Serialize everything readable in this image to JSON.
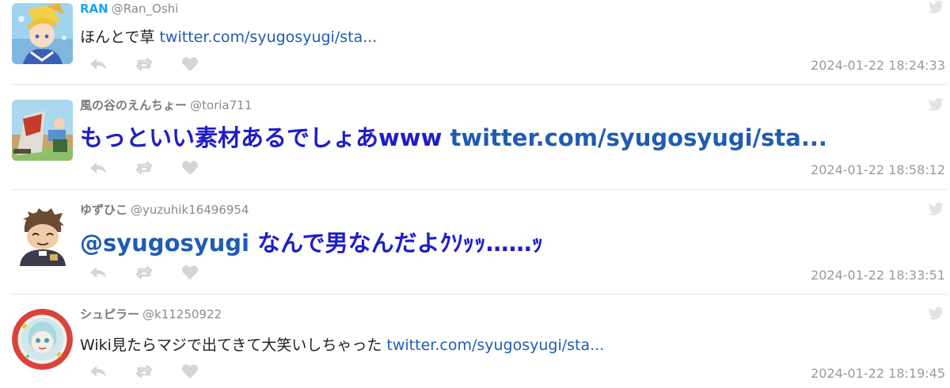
{
  "tweets": [
    {
      "name": "RAN",
      "handle": "@Ran_Oshi",
      "text": "ほんとで草 ",
      "link": "twitter.com/syugosyugi/sta...",
      "time": "2024-01-22 18:24:33"
    },
    {
      "name": "風の谷のえんちょー",
      "handle": "@toria711",
      "text": "もっといい素材あるでしょあwww ",
      "link": "twitter.com/syugosyugi/sta...",
      "time": "2024-01-22 18:58:12"
    },
    {
      "name": "ゆずひこ",
      "handle": "@yuzuhik16496954",
      "mention": "@syugosyugi",
      "text": " なんで男なんだよｸｿｯｯ……ｯ",
      "time": "2024-01-22 18:33:51"
    },
    {
      "name": "シュピラー",
      "handle": "@k11250922",
      "text": "Wiki見たらマジで出てきて大笑いしちゃった ",
      "link": "twitter.com/syugosyugi/sta...",
      "time": "2024-01-22 18:19:45"
    }
  ],
  "icons": {
    "reply": "reply-icon",
    "retweet": "retweet-icon",
    "like": "heart-icon",
    "source": "twitter-bird-icon"
  },
  "colors": {
    "name_highlight": "#1da1f2",
    "link": "#1f5cb3",
    "big_text": "#1d1dc9",
    "icon": "#d5d5d5"
  }
}
